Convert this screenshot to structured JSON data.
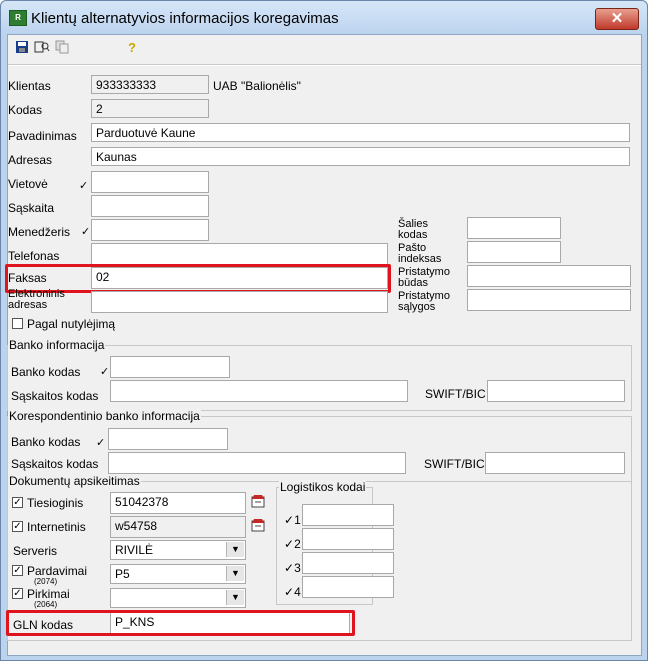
{
  "window": {
    "title": "Klientų alternatyvios informacijos koregavimas",
    "close": "✕"
  },
  "toolbar": {
    "help": "?"
  },
  "client_section": {
    "klientas_label": "Klientas",
    "klientas_value": "933333333",
    "klientas_name": "UAB \"Balionėlis\"",
    "kodas_label": "Kodas",
    "kodas_value": "2",
    "pavadinimas_label": "Pavadinimas",
    "pavadinimas_value": "Parduotuvė Kaune",
    "adresas_label": "Adresas",
    "adresas_value": "Kaunas",
    "vietove_label": "Vietovė",
    "saskaita_label": "Sąskaita",
    "menedzeris_label": "Menedžeris",
    "telefonas_label": "Telefonas",
    "faksas_label": "Faksas",
    "faksas_value": "02",
    "el_adresas_label_1": "Elektroninis",
    "el_adresas_label_2": "adresas",
    "salies_kodas_1": "Šalies",
    "salies_kodas_2": "kodas",
    "pasto_indeksas_1": "Pašto",
    "pasto_indeksas_2": "indeksas",
    "pristatymo_budas_1": "Pristatymo",
    "pristatymo_budas_2": "būdas",
    "pristatymo_salygos_1": "Pristatymo",
    "pristatymo_salygos_2": "sąlygos",
    "pagal_nutylejima": "Pagal nutylėjimą"
  },
  "bank": {
    "title": "Banko informacija",
    "banko_kodas": "Banko kodas",
    "saskaitos_kodas": "Sąskaitos kodas",
    "swift": "SWIFT/BIC"
  },
  "corr_bank": {
    "title": "Korespondentinio banko informacija",
    "banko_kodas": "Banko kodas",
    "saskaitos_kodas": "Sąskaitos kodas",
    "swift": "SWIFT/BIC"
  },
  "docs": {
    "title": "Dokumentų apsikeitimas",
    "tiesioginis_label": "Tiesioginis",
    "tiesioginis_value": "51042378",
    "internetinis_label": "Internetinis",
    "internetinis_value": "w54758",
    "serveris_label": "Serveris",
    "serveris_value": "RIVILĖ",
    "pardavimai_label": "Pardavimai",
    "pardavimai_code": "(2074)",
    "pardavimai_value": "P5",
    "pirkimai_label": "Pirkimai",
    "pirkimai_code": "(2064)",
    "pirkimai_value": "",
    "gln_label": "GLN kodas",
    "gln_value": "P_KNS"
  },
  "logistics": {
    "title": "Logistikos kodai",
    "rows": [
      "1",
      "2",
      "3",
      "4"
    ]
  }
}
